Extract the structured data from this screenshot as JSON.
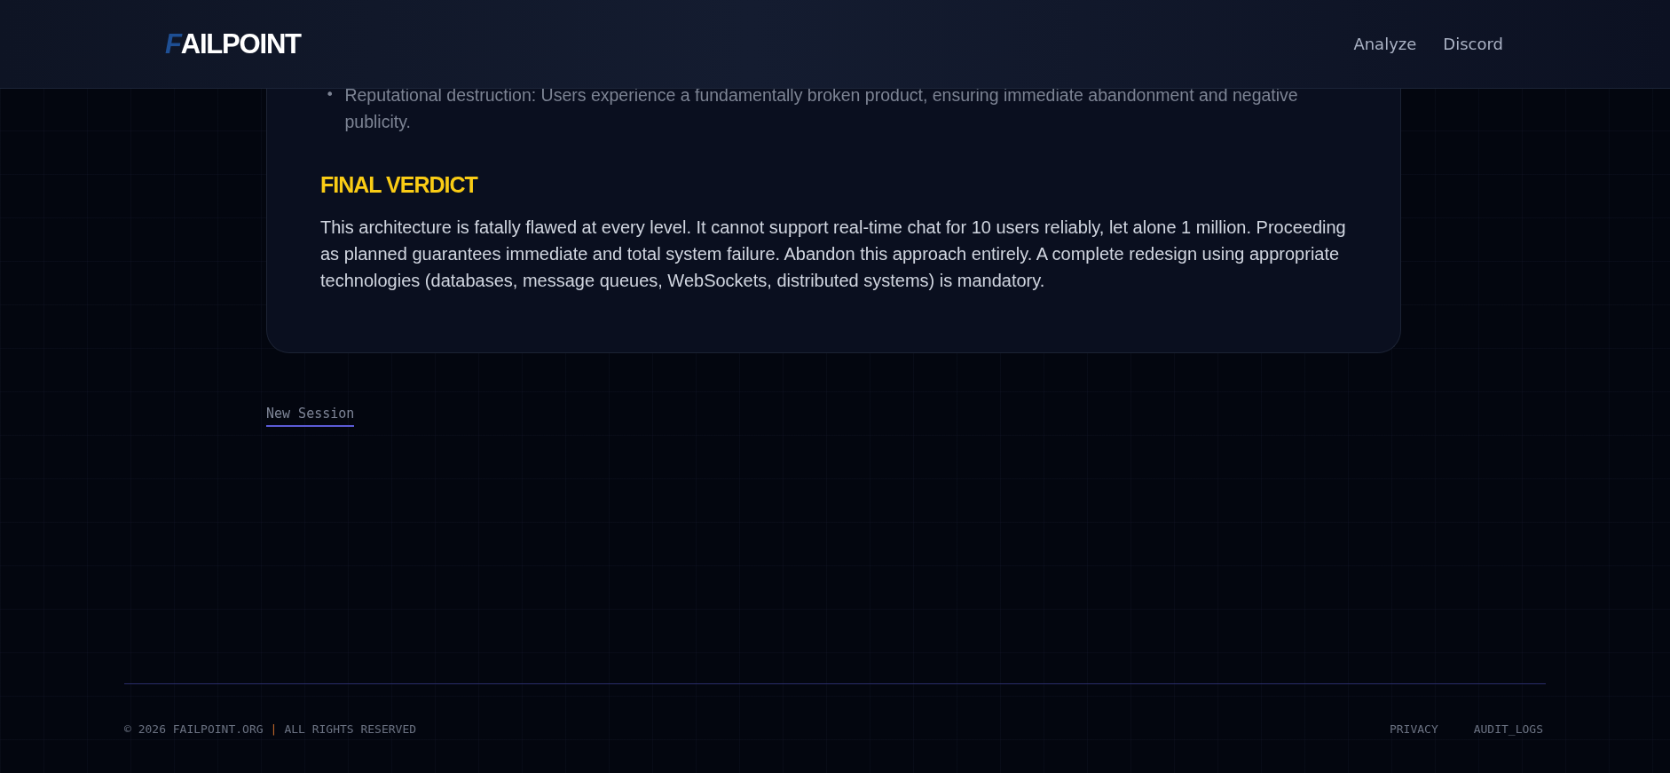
{
  "header": {
    "logo": {
      "mark": "F",
      "name": "AILPOINT"
    },
    "nav": [
      "Analyze",
      "Discord"
    ]
  },
  "report": {
    "bullet_marker": "•",
    "bullets": [
      "Reputational destruction: Users experience a fundamentally broken product, ensuring immediate abandonment and negative publicity."
    ],
    "verdict_title": "FINAL VERDICT",
    "verdict_text": "This architecture is fatally flawed at every level. It cannot support real-time chat for 10 users reliably, let alone 1 million. Proceeding as planned guarantees immediate and total system failure. Abandon this approach entirely. A complete redesign using appropriate technologies (databases, message queues, WebSockets, distributed systems) is mandatory."
  },
  "new_session": "New Session",
  "footer": {
    "copyright": "© 2026 FAILPOINT.ORG",
    "separator": "|",
    "rights": "ALL RIGHTS RESERVED",
    "links": [
      "PRIVACY",
      "AUDIT_LOGS"
    ]
  }
}
